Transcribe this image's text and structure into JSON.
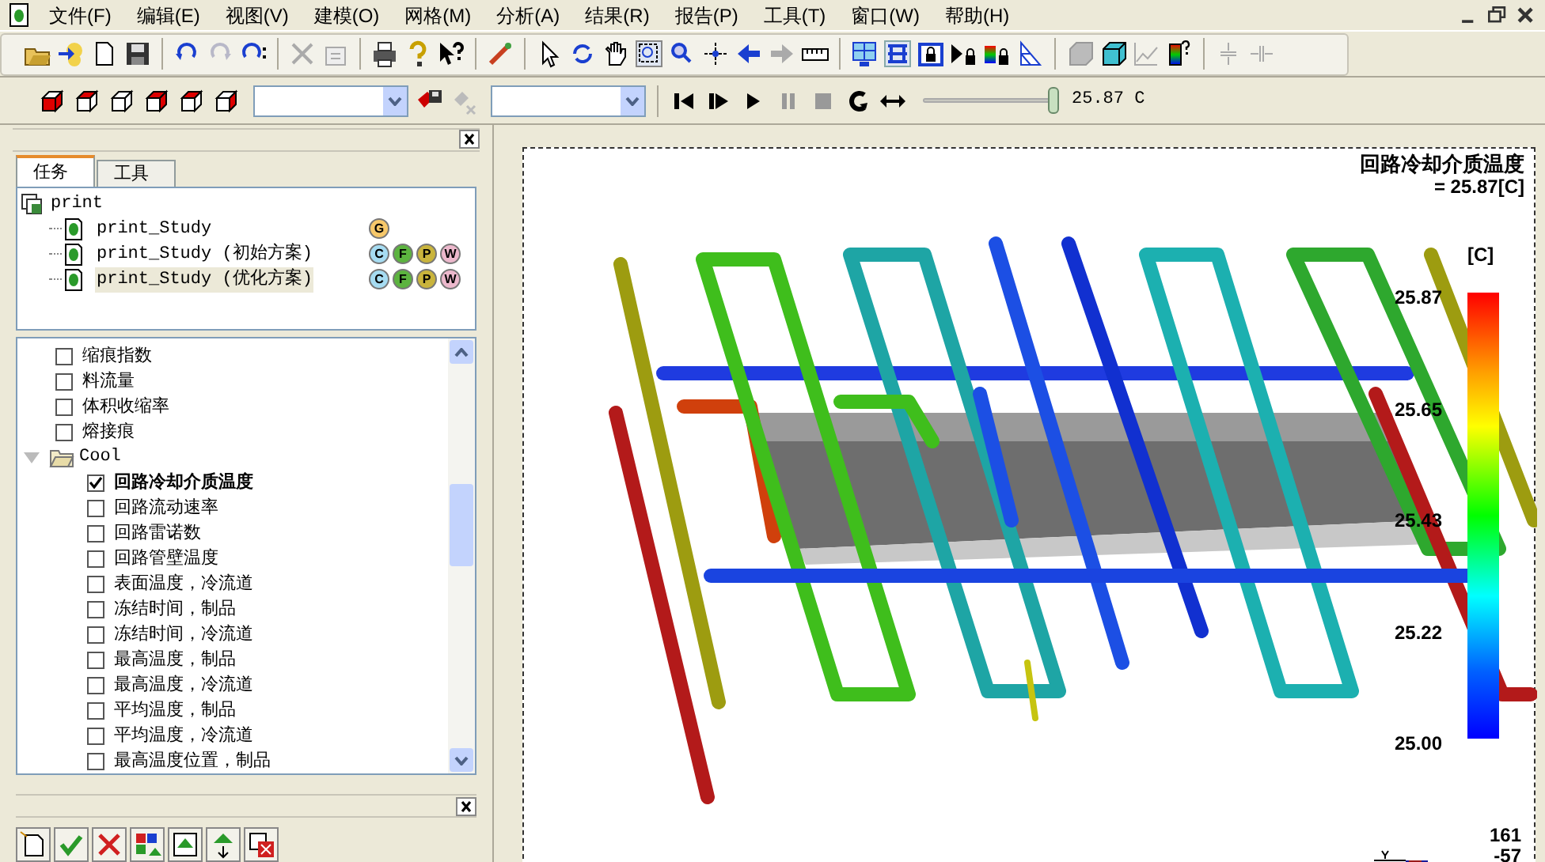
{
  "menu": [
    "文件(F)",
    "编辑(E)",
    "视图(V)",
    "建模(O)",
    "网格(M)",
    "分析(A)",
    "结果(R)",
    "报告(P)",
    "工具(T)",
    "窗口(W)",
    "帮助(H)"
  ],
  "playback": {
    "level": 1,
    "reading": "25.87 C"
  },
  "panel_tabs": [
    {
      "label": "任务",
      "selected": true
    },
    {
      "label": "工具",
      "selected": false
    }
  ],
  "project": {
    "name": "print",
    "studies": [
      {
        "name": "print_Study",
        "selected": false,
        "badges": [
          {
            "text": "G",
            "color": "#f7c86a"
          }
        ]
      },
      {
        "name": "print_Study (初始方案)",
        "selected": false,
        "badges": [
          {
            "text": "C",
            "color": "#a6dcf2"
          },
          {
            "text": "F",
            "color": "#5cb33f"
          },
          {
            "text": "P",
            "color": "#c9b43c"
          },
          {
            "text": "W",
            "color": "#ecb8cc"
          }
        ]
      },
      {
        "name": "print_Study (优化方案)",
        "selected": true,
        "badges": [
          {
            "text": "C",
            "color": "#a6dcf2"
          },
          {
            "text": "F",
            "color": "#5cb33f"
          },
          {
            "text": "P",
            "color": "#c9b43c"
          },
          {
            "text": "W",
            "color": "#ecb8cc"
          }
        ]
      }
    ]
  },
  "result_tree": [
    {
      "kind": "check",
      "label": "缩痕指数",
      "checked": false
    },
    {
      "kind": "check",
      "label": "料流量",
      "checked": false
    },
    {
      "kind": "check",
      "label": "体积收缩率",
      "checked": false
    },
    {
      "kind": "check",
      "label": "熔接痕",
      "checked": false
    },
    {
      "kind": "folder",
      "label": "Cool",
      "expanded": true,
      "children": [
        {
          "kind": "check",
          "label": "回路冷却介质温度",
          "checked": true
        },
        {
          "kind": "check",
          "label": "回路流动速率",
          "checked": false
        },
        {
          "kind": "check",
          "label": "回路雷诺数",
          "checked": false
        },
        {
          "kind": "check",
          "label": "回路管壁温度",
          "checked": false
        },
        {
          "kind": "check",
          "label": "表面温度，冷流道",
          "checked": false
        },
        {
          "kind": "check",
          "label": "冻结时间，制品",
          "checked": false
        },
        {
          "kind": "check",
          "label": "冻结时间，冷流道",
          "checked": false
        },
        {
          "kind": "check",
          "label": "最高温度，制品",
          "checked": false
        },
        {
          "kind": "check",
          "label": "最高温度，冷流道",
          "checked": false
        },
        {
          "kind": "check",
          "label": "平均温度，制品",
          "checked": false
        },
        {
          "kind": "check",
          "label": "平均温度，冷流道",
          "checked": false
        },
        {
          "kind": "check",
          "label": "最高温度位置，制品",
          "checked": false
        }
      ]
    }
  ],
  "plot": {
    "title": "回路冷却介质温度",
    "value": "= 25.87[C]",
    "unit": "[C]",
    "scale_labels": [
      "25.87",
      "25.65",
      "25.43",
      "25.22",
      "25.00"
    ],
    "corner_numbers": [
      "161",
      "-57"
    ]
  }
}
